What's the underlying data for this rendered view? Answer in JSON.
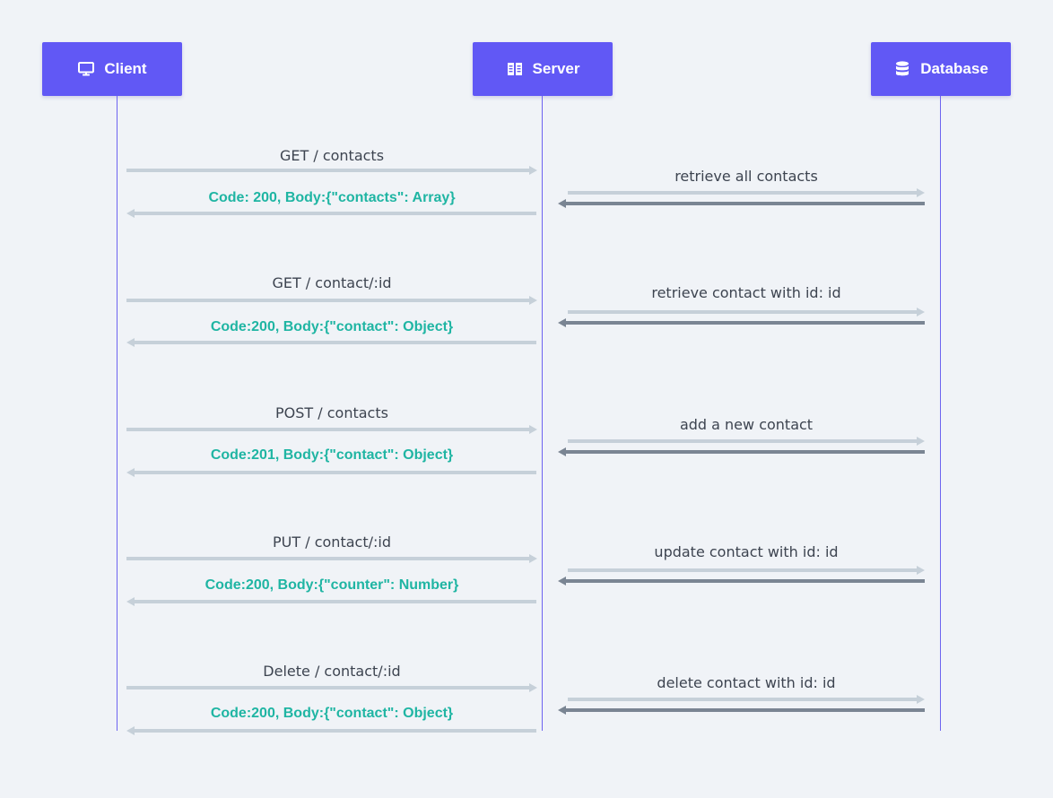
{
  "actors": {
    "client": {
      "label": "Client",
      "icon": "monitor-icon"
    },
    "server": {
      "label": "Server",
      "icon": "server-icon"
    },
    "database": {
      "label": "Database",
      "icon": "database-icon"
    }
  },
  "colors": {
    "actor_bg": "#6158f5",
    "lifeline": "#6d63f0",
    "request_arrow": "#c6d0d9",
    "db_return_arrow": "#7a8593",
    "request_text": "#3d4450",
    "response_text": "#1fb5a3",
    "background": "#f0f3f7"
  },
  "interactions": [
    {
      "request": "GET / contacts",
      "response": "Code: 200, Body:{\"contacts\": Array}",
      "db_action": "retrieve all contacts"
    },
    {
      "request": "GET / contact/:id",
      "response": "Code:200, Body:{\"contact\": Object}",
      "db_action": "retrieve contact with id: id"
    },
    {
      "request": "POST / contacts",
      "response": "Code:201, Body:{\"contact\": Object}",
      "db_action": "add a new contact"
    },
    {
      "request": "PUT / contact/:id",
      "response": "Code:200, Body:{\"counter\": Number}",
      "db_action": "update contact with id: id"
    },
    {
      "request": "Delete / contact/:id",
      "response": "Code:200, Body:{\"contact\": Object}",
      "db_action": "delete contact with id: id"
    }
  ]
}
